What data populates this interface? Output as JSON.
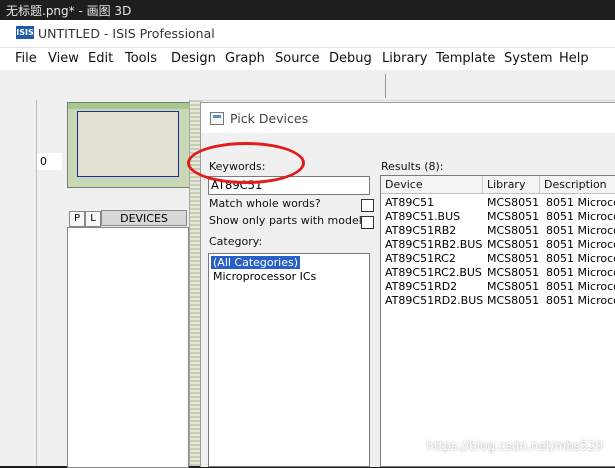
{
  "outer_window": {
    "title": "无标题.png* - 画图 3D"
  },
  "app": {
    "logo_text": "ISIS",
    "title": "UNTITLED - ISIS Professional",
    "menu": [
      "File",
      "View",
      "Edit",
      "Tools",
      "Design",
      "Graph",
      "Source",
      "Debug",
      "Library",
      "Template",
      "System",
      "Help"
    ]
  },
  "left_panel": {
    "zero_value": "0",
    "pl_buttons": [
      "P",
      "L"
    ],
    "devices_header": "DEVICES"
  },
  "dialog": {
    "title": "Pick Devices",
    "keywords_label": "Keywords:",
    "keywords_value": "AT89C51",
    "match_whole_words_label": "Match whole words?",
    "show_only_models_label": "Show only parts with models?",
    "category_label": "Category:",
    "categories": [
      "(All Categories)",
      "Microprocessor ICs"
    ],
    "results_label": "Results (8):",
    "results_columns": [
      "Device",
      "Library",
      "Description"
    ],
    "results": [
      {
        "device": "AT89C51",
        "library": "MCS8051",
        "description": "8051 Microco"
      },
      {
        "device": "AT89C51.BUS",
        "library": "MCS8051",
        "description": "8051 Microco"
      },
      {
        "device": "AT89C51RB2",
        "library": "MCS8051",
        "description": "8051 Microco"
      },
      {
        "device": "AT89C51RB2.BUS",
        "library": "MCS8051",
        "description": "8051 Microco"
      },
      {
        "device": "AT89C51RC2",
        "library": "MCS8051",
        "description": "8051 Microco"
      },
      {
        "device": "AT89C51RC2.BUS",
        "library": "MCS8051",
        "description": "8051 Microco"
      },
      {
        "device": "AT89C51RD2",
        "library": "MCS8051",
        "description": "8051 Microco"
      },
      {
        "device": "AT89C51RD2.BUS",
        "library": "MCS8051",
        "description": "8051 Microco"
      }
    ]
  },
  "watermark": "https://blog.csdn.net/mbs520",
  "colors": {
    "highlight_ellipse": "#e21b1b",
    "selection": "#2860c8"
  }
}
